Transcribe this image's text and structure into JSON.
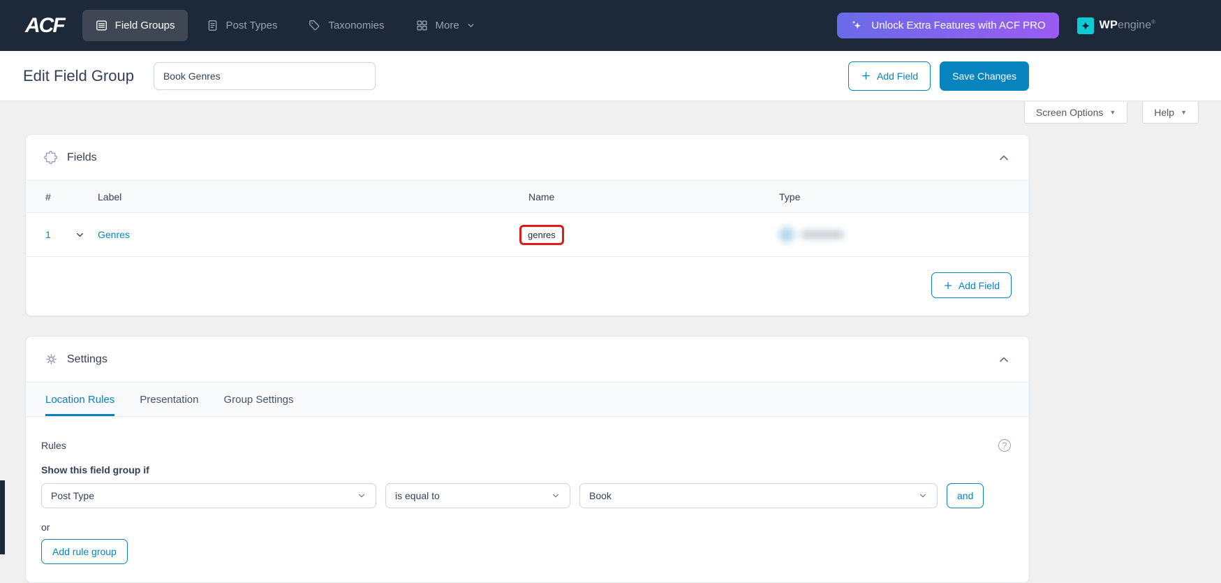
{
  "colors": {
    "accent_blue": "#0783be",
    "navbar_bg": "#1d2939",
    "pro_gradient_start": "#6a6be8",
    "pro_gradient_end": "#9a5cf3",
    "annotation_red": "#de1a1a",
    "brand_teal": "#0ecad4",
    "page_bg": "#f0f0f1"
  },
  "navbar": {
    "logo_text": "ACF",
    "items": [
      {
        "label": "Field Groups",
        "icon": "list-icon",
        "active": true
      },
      {
        "label": "Post Types",
        "icon": "document-icon",
        "active": false
      },
      {
        "label": "Taxonomies",
        "icon": "tag-icon",
        "active": false
      },
      {
        "label": "More",
        "icon": "grid-icon",
        "active": false,
        "has_chevron": true
      }
    ],
    "pro_button_label": "Unlock Extra Features with ACF PRO",
    "brand": {
      "wp": "WP",
      "engine": "engine",
      "reg": "®"
    }
  },
  "header": {
    "title": "Edit Field Group",
    "title_input_value": "Book Genres",
    "add_field_label": "Add Field",
    "save_label": "Save Changes"
  },
  "meta_tabs": {
    "screen_options": "Screen Options",
    "help": "Help"
  },
  "fields_panel": {
    "title": "Fields",
    "columns": [
      "#",
      "Label",
      "Name",
      "Type"
    ],
    "rows": [
      {
        "order": "1",
        "label": "Genres",
        "name": "genres",
        "type_redacted": true
      }
    ],
    "add_field_label": "Add Field"
  },
  "settings_panel": {
    "title": "Settings",
    "tabs": [
      {
        "label": "Location Rules",
        "active": true
      },
      {
        "label": "Presentation",
        "active": false
      },
      {
        "label": "Group Settings",
        "active": false
      }
    ],
    "rules": {
      "section_label": "Rules",
      "condition_label": "Show this field group if",
      "selects": [
        {
          "value": "Post Type"
        },
        {
          "value": "is equal to"
        },
        {
          "value": "Book"
        }
      ],
      "and_label": "and",
      "or_label": "or",
      "add_rule_group_label": "Add rule group"
    }
  },
  "icons": {
    "question_glyph": "?",
    "triangle_glyph": "▼"
  }
}
